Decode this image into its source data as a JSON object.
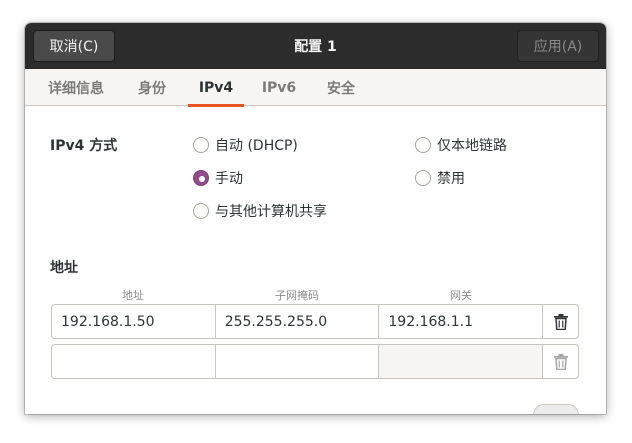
{
  "titlebar": {
    "cancel_label": "取消(C)",
    "title": "配置 1",
    "apply_label": "应用(A)"
  },
  "tabs": [
    {
      "label": "详细信息"
    },
    {
      "label": "身份"
    },
    {
      "label": "IPv4"
    },
    {
      "label": "IPv6"
    },
    {
      "label": "安全"
    }
  ],
  "ipv4": {
    "method_label": "IPv4 方式",
    "options": [
      {
        "label": "自动 (DHCP)",
        "selected": false
      },
      {
        "label": "仅本地链路",
        "selected": false
      },
      {
        "label": "手动",
        "selected": true
      },
      {
        "label": "禁用",
        "selected": false
      },
      {
        "label": "与其他计算机共享",
        "selected": false
      }
    ]
  },
  "addresses": {
    "section_label": "地址",
    "columns": [
      "地址",
      "子网掩码",
      "网关"
    ],
    "rows": [
      {
        "address": "192.168.1.50",
        "netmask": "255.255.255.0",
        "gateway": "192.168.1.1"
      },
      {
        "address": "",
        "netmask": "",
        "gateway": ""
      }
    ]
  },
  "icons": {
    "delete": "trash-icon",
    "accent": "#e95420",
    "radio_selected": "#924d8b"
  }
}
